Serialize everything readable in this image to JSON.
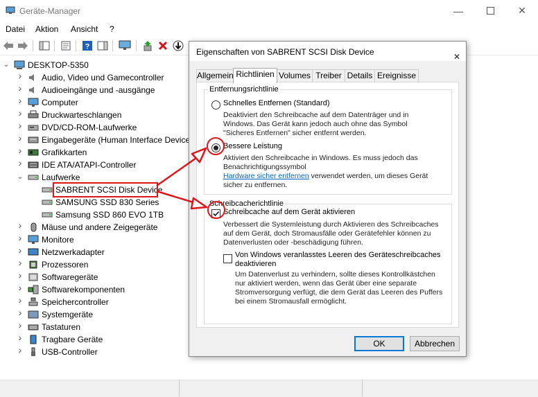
{
  "window": {
    "title": "Geräte-Manager"
  },
  "menu": [
    "Datei",
    "Aktion",
    "Ansicht",
    "?"
  ],
  "tree": {
    "root": "DESKTOP-5350",
    "categories": [
      {
        "label": "Audio, Video und Gamecontroller",
        "icon": "speaker-icon"
      },
      {
        "label": "Audioeingänge und -ausgänge",
        "icon": "speaker-icon"
      },
      {
        "label": "Computer",
        "icon": "monitor-icon"
      },
      {
        "label": "Druckwarteschlangen",
        "icon": "printer-icon"
      },
      {
        "label": "DVD/CD-ROM-Laufwerke",
        "icon": "disc-icon"
      },
      {
        "label": "Eingabegeräte (Human Interface Devices)",
        "icon": "hid-icon"
      },
      {
        "label": "Grafikkarten",
        "icon": "display-adapter-icon"
      },
      {
        "label": "IDE ATA/ATAPI-Controller",
        "icon": "controller-icon"
      },
      {
        "label": "Laufwerke",
        "icon": "drive-icon"
      },
      {
        "label": "Mäuse und andere Zeigegeräte",
        "icon": "mouse-icon"
      },
      {
        "label": "Monitore",
        "icon": "monitor-icon"
      },
      {
        "label": "Netzwerkadapter",
        "icon": "network-icon"
      },
      {
        "label": "Prozessoren",
        "icon": "cpu-icon"
      },
      {
        "label": "Softwaregeräte",
        "icon": "software-device-icon"
      },
      {
        "label": "Softwarekomponenten",
        "icon": "software-component-icon"
      },
      {
        "label": "Speichercontroller",
        "icon": "storage-controller-icon"
      },
      {
        "label": "Systemgeräte",
        "icon": "system-device-icon"
      },
      {
        "label": "Tastaturen",
        "icon": "keyboard-icon"
      },
      {
        "label": "Tragbare Geräte",
        "icon": "portable-device-icon"
      },
      {
        "label": "USB-Controller",
        "icon": "usb-icon"
      }
    ],
    "drives": [
      "SABRENT  SCSI Disk Device",
      "SAMSUNG SSD 830 Series",
      "Samsung SSD 860 EVO 1TB"
    ]
  },
  "dialog": {
    "title": "Eigenschaften von SABRENT  SCSI Disk Device",
    "tabs": [
      "Allgemein",
      "Richtlinien",
      "Volumes",
      "Treiber",
      "Details",
      "Ereignisse"
    ],
    "active_tab": "Richtlinien",
    "removal_group": {
      "label": "Entfernungsrichtlinie",
      "quick": {
        "label": "Schnelles Entfernen (Standard)",
        "desc": [
          "Deaktiviert den Schreibcache auf dem Datenträger und in",
          "Windows. Das Gerät kann jedoch auch ohne das Symbol",
          "\"Sicheres Entfernen\" sicher entfernt werden."
        ],
        "selected": false
      },
      "better": {
        "label": "Bessere Leistung",
        "desc": [
          "Aktiviert den Schreibcache in Windows. Es muss jedoch das",
          "Benachrichtigungssymbol"
        ],
        "link": "Hardware sicher entfernen",
        "desc_after_link": " verwendet werden, um dieses Gerät",
        "desc_last": "sicher zu entfernen.",
        "selected": true
      }
    },
    "cache_group": {
      "label": "Schreibcacherichtlinie",
      "enable": {
        "label": "Schreibcache auf dem Gerät aktivieren",
        "desc": [
          "Verbessert die Systemleistung durch Aktivieren des Schreibcaches",
          "auf dem Gerät, doch Stromausfälle oder Gerätefehler können zu",
          "Datenverlusten oder -beschädigung führen."
        ],
        "checked": true
      },
      "flush": {
        "label": [
          "Von Windows veranlasstes Leeren des Geräteschreibcaches",
          "deaktivieren"
        ],
        "desc": [
          "Um Datenverlust zu verhindern, sollte dieses Kontrollkästchen",
          "nur aktiviert werden, wenn das Gerät über eine separate",
          "Stromversorgung verfügt, die dem Gerät das Leeren des Puffers",
          "bei einem Stromausfall ermöglicht."
        ],
        "checked": false
      }
    },
    "ok": "OK",
    "cancel": "Abbrechen"
  },
  "colors": {
    "highlight": "#e0151a",
    "link": "#0066cc",
    "default_button": "#0078d7"
  }
}
